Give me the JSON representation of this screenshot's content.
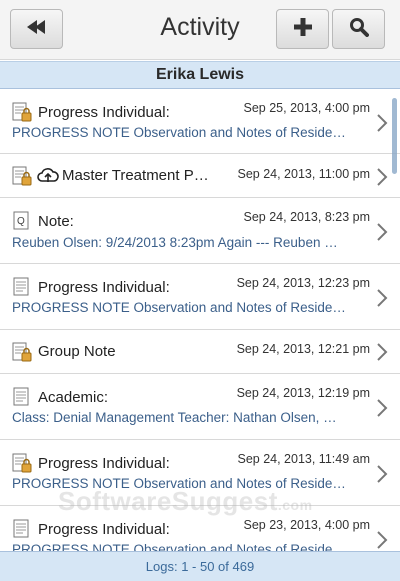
{
  "header": {
    "title": "Activity",
    "back_icon": "back-arrow-icon",
    "add_icon": "plus-icon",
    "search_icon": "search-icon"
  },
  "patient_name": "Erika Lewis",
  "rows": [
    {
      "icon": "locked-document-icon",
      "title": "Progress Individual:",
      "date": "Sep 25, 2013, 4:00 pm",
      "subtitle": "PROGRESS NOTE Observation and Notes of Reside…"
    },
    {
      "icon": "locked-document-icon",
      "extra_icon": "cloud-upload-icon",
      "title": "Master Treatment P…",
      "date": "Sep 24, 2013, 11:00 pm",
      "subtitle": ""
    },
    {
      "icon": "quick-note-icon",
      "title": "Note:",
      "date": "Sep 24, 2013, 8:23 pm",
      "subtitle": "Reuben Olsen: 9/24/2013 8:23pm Again --- Reuben …"
    },
    {
      "icon": "document-icon",
      "title": "Progress Individual:",
      "date": "Sep 24, 2013, 12:23 pm",
      "subtitle": "PROGRESS NOTE Observation and Notes of Reside…"
    },
    {
      "icon": "locked-document-icon",
      "title": "Group Note",
      "date": "Sep 24, 2013, 12:21 pm",
      "subtitle": ""
    },
    {
      "icon": "document-icon",
      "title": "Academic:",
      "date": "Sep 24, 2013, 12:19 pm",
      "subtitle": "Class: Denial Management Teacher: Nathan Olsen, …"
    },
    {
      "icon": "locked-document-icon",
      "title": "Progress Individual:",
      "date": "Sep 24, 2013, 11:49 am",
      "subtitle": "PROGRESS NOTE Observation and Notes of Reside…"
    },
    {
      "icon": "document-icon",
      "title": "Progress Individual:",
      "date": "Sep 23, 2013, 4:00 pm",
      "subtitle": "PROGRESS NOTE Observation and Notes of Reside…"
    }
  ],
  "footer": {
    "text": "Logs: 1 - 50 of 469"
  },
  "watermark": {
    "main": "SoftwareSuggest",
    "suffix": ".com"
  }
}
